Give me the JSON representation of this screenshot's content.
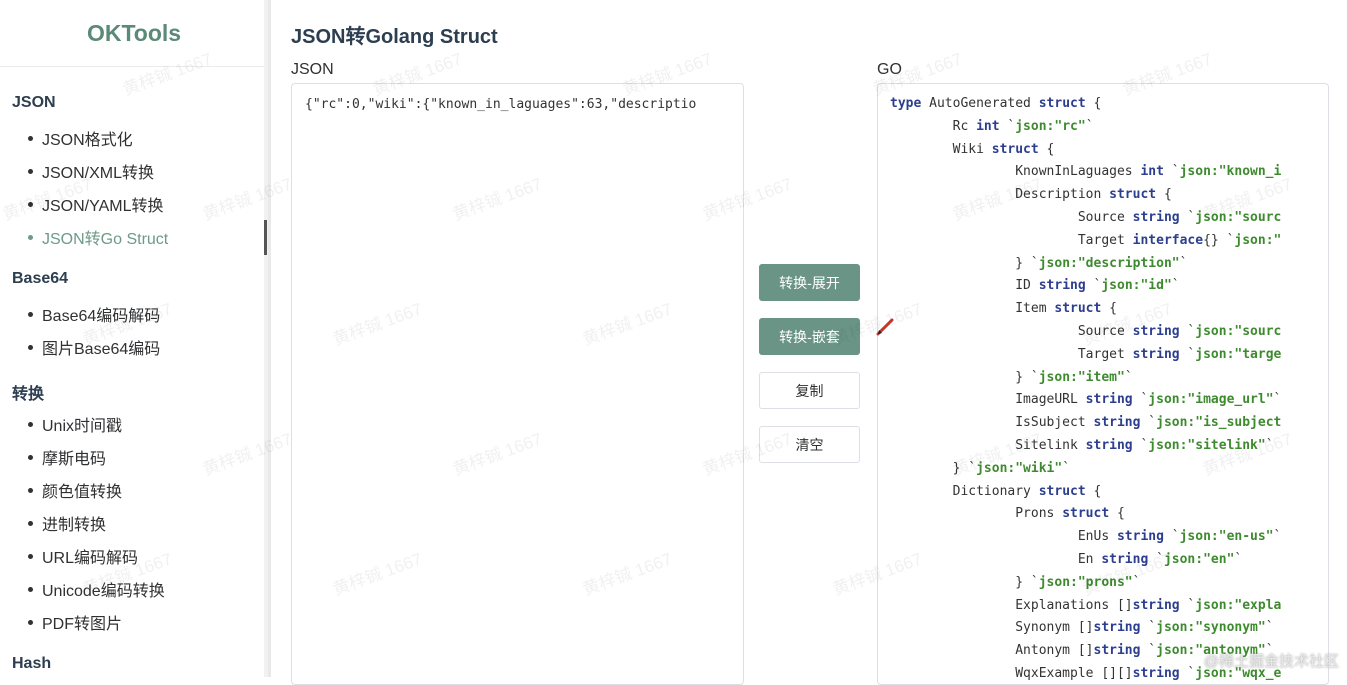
{
  "app": {
    "logo": "OKTools"
  },
  "sidebar": {
    "sections": [
      {
        "title": "JSON",
        "items": [
          "JSON格式化",
          "JSON/XML转换",
          "JSON/YAML转换",
          "JSON转Go Struct"
        ]
      },
      {
        "title": "Base64",
        "items": [
          "Base64编码解码",
          "图片Base64编码"
        ]
      },
      {
        "title": "转换",
        "items": [
          "Unix时间戳",
          "摩斯电码",
          "颜色值转换",
          "进制转换",
          "URL编码解码",
          "Unicode编码转换",
          "PDF转图片"
        ]
      },
      {
        "title": "Hash",
        "items": []
      }
    ],
    "active_item": "JSON转Go Struct"
  },
  "main": {
    "title": "JSON转Golang Struct",
    "json_label": "JSON",
    "go_label": "GO",
    "json_input": "{\"rc\":0,\"wiki\":{\"known_in_laguages\":63,\"descriptio",
    "buttons": {
      "expand": "转换-展开",
      "nested": "转换-嵌套",
      "copy": "复制",
      "clear": "清空"
    },
    "go_output": [
      [
        {
          "t": "type",
          "k": "kw"
        },
        {
          "t": " AutoGenerated "
        },
        {
          "t": "struct",
          "k": "kw"
        },
        {
          "t": " {"
        }
      ],
      [
        {
          "t": "        Rc "
        },
        {
          "t": "int",
          "k": "kw"
        },
        {
          "t": " `"
        },
        {
          "t": "json:\"rc\"",
          "k": "tg"
        },
        {
          "t": "`"
        }
      ],
      [
        {
          "t": "        Wiki "
        },
        {
          "t": "struct",
          "k": "kw"
        },
        {
          "t": " {"
        }
      ],
      [
        {
          "t": "                KnownInLaguages "
        },
        {
          "t": "int",
          "k": "kw"
        },
        {
          "t": " `"
        },
        {
          "t": "json:\"known_i",
          "k": "tg"
        }
      ],
      [
        {
          "t": "                Description "
        },
        {
          "t": "struct",
          "k": "kw"
        },
        {
          "t": " {"
        }
      ],
      [
        {
          "t": "                        Source "
        },
        {
          "t": "string",
          "k": "kw"
        },
        {
          "t": " `"
        },
        {
          "t": "json:\"sourc",
          "k": "tg"
        }
      ],
      [
        {
          "t": "                        Target "
        },
        {
          "t": "interface",
          "k": "kw"
        },
        {
          "t": "{} `"
        },
        {
          "t": "json:\"",
          "k": "tg"
        }
      ],
      [
        {
          "t": "                } `"
        },
        {
          "t": "json:\"description\"",
          "k": "tg"
        },
        {
          "t": "`"
        }
      ],
      [
        {
          "t": "                ID "
        },
        {
          "t": "string",
          "k": "kw"
        },
        {
          "t": " `"
        },
        {
          "t": "json:\"id\"",
          "k": "tg"
        },
        {
          "t": "`"
        }
      ],
      [
        {
          "t": "                Item "
        },
        {
          "t": "struct",
          "k": "kw"
        },
        {
          "t": " {"
        }
      ],
      [
        {
          "t": "                        Source "
        },
        {
          "t": "string",
          "k": "kw"
        },
        {
          "t": " `"
        },
        {
          "t": "json:\"sourc",
          "k": "tg"
        }
      ],
      [
        {
          "t": "                        Target "
        },
        {
          "t": "string",
          "k": "kw"
        },
        {
          "t": " `"
        },
        {
          "t": "json:\"targe",
          "k": "tg"
        }
      ],
      [
        {
          "t": "                } `"
        },
        {
          "t": "json:\"item\"",
          "k": "tg"
        },
        {
          "t": "`"
        }
      ],
      [
        {
          "t": "                ImageURL "
        },
        {
          "t": "string",
          "k": "kw"
        },
        {
          "t": " `"
        },
        {
          "t": "json:\"image_url\"",
          "k": "tg"
        },
        {
          "t": "`"
        }
      ],
      [
        {
          "t": "                IsSubject "
        },
        {
          "t": "string",
          "k": "kw"
        },
        {
          "t": " `"
        },
        {
          "t": "json:\"is_subject",
          "k": "tg"
        }
      ],
      [
        {
          "t": "                Sitelink "
        },
        {
          "t": "string",
          "k": "kw"
        },
        {
          "t": " `"
        },
        {
          "t": "json:\"sitelink\"",
          "k": "tg"
        },
        {
          "t": "`"
        }
      ],
      [
        {
          "t": "        } `"
        },
        {
          "t": "json:\"wiki\"",
          "k": "tg"
        },
        {
          "t": "`"
        }
      ],
      [
        {
          "t": "        Dictionary "
        },
        {
          "t": "struct",
          "k": "kw"
        },
        {
          "t": " {"
        }
      ],
      [
        {
          "t": "                Prons "
        },
        {
          "t": "struct",
          "k": "kw"
        },
        {
          "t": " {"
        }
      ],
      [
        {
          "t": "                        EnUs "
        },
        {
          "t": "string",
          "k": "kw"
        },
        {
          "t": " `"
        },
        {
          "t": "json:\"en-us\"",
          "k": "tg"
        },
        {
          "t": "`"
        }
      ],
      [
        {
          "t": "                        En "
        },
        {
          "t": "string",
          "k": "kw"
        },
        {
          "t": " `"
        },
        {
          "t": "json:\"en\"",
          "k": "tg"
        },
        {
          "t": "`"
        }
      ],
      [
        {
          "t": "                } `"
        },
        {
          "t": "json:\"prons\"",
          "k": "tg"
        },
        {
          "t": "`"
        }
      ],
      [
        {
          "t": "                Explanations []"
        },
        {
          "t": "string",
          "k": "kw"
        },
        {
          "t": " `"
        },
        {
          "t": "json:\"expla",
          "k": "tg"
        }
      ],
      [
        {
          "t": "                Synonym []"
        },
        {
          "t": "string",
          "k": "kw"
        },
        {
          "t": " `"
        },
        {
          "t": "json:\"synonym\"",
          "k": "tg"
        },
        {
          "t": "`"
        }
      ],
      [
        {
          "t": "                Antonym []"
        },
        {
          "t": "string",
          "k": "kw"
        },
        {
          "t": " `"
        },
        {
          "t": "json:\"antonym\"",
          "k": "tg"
        },
        {
          "t": "`"
        }
      ],
      [
        {
          "t": "                WqxExample [][]"
        },
        {
          "t": "string",
          "k": "kw"
        },
        {
          "t": " `"
        },
        {
          "t": "json:\"wqx_e",
          "k": "tg"
        }
      ]
    ]
  },
  "watermark": {
    "text": "黄梓铖 1667",
    "corner": "@稀土掘金技术社区"
  },
  "colors": {
    "accent": "#6a9586",
    "logo": "#5b8a78",
    "keyword": "#2c3e8f",
    "tag": "#3e8b2f"
  }
}
